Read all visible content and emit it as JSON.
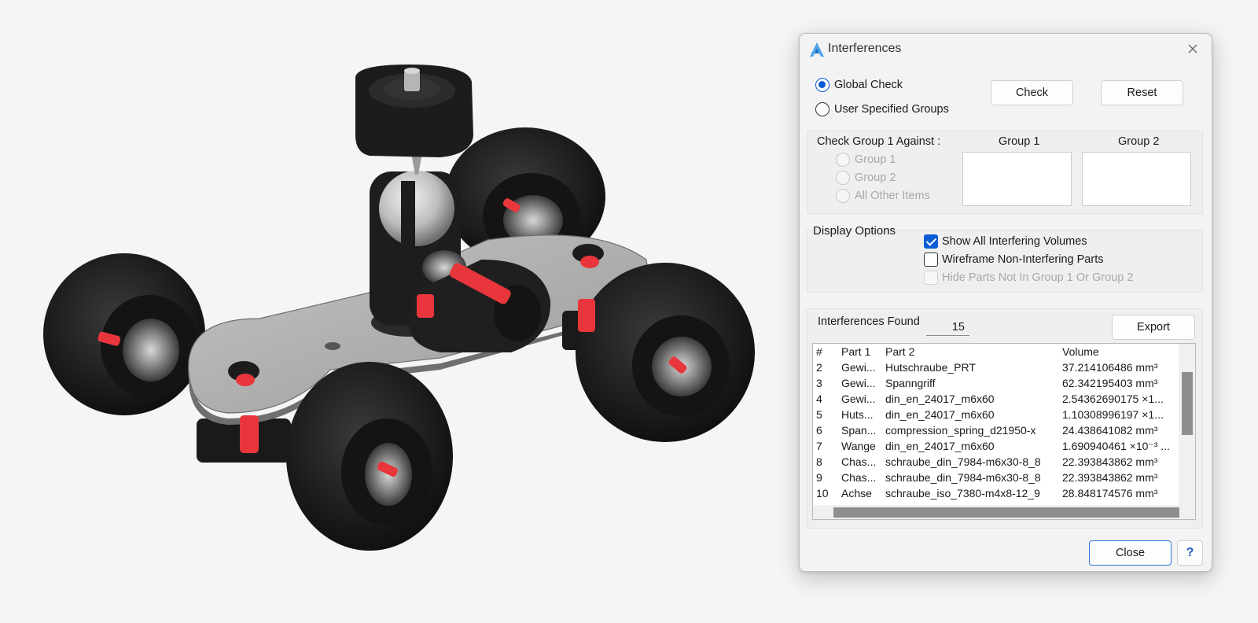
{
  "dialog": {
    "title": "Interferences",
    "mode_global": "Global Check",
    "mode_user": "User Specified Groups",
    "check_label": "Check",
    "reset_label": "Reset",
    "check_group_label": "Check Group 1 Against :",
    "against_group1": "Group 1",
    "against_group2": "Group 2",
    "against_other": "All Other Items",
    "group1_header": "Group 1",
    "group2_header": "Group 2",
    "display_options_label": "Display Options",
    "opt_show_all": "Show All Interfering Volumes",
    "opt_wireframe": "Wireframe Non-Interfering Parts",
    "opt_hide": "Hide Parts Not In Group 1 Or Group 2",
    "interferences_found_label": "Interferences Found",
    "interferences_count": "15",
    "export_label": "Export",
    "close_label": "Close",
    "help_label": "?"
  },
  "table": {
    "headers": [
      "#",
      "Part 1",
      "Part 2",
      "Volume"
    ],
    "rows": [
      [
        "2",
        "Gewi...",
        "Hutschraube_PRT",
        "37.214106486 mm³"
      ],
      [
        "3",
        "Gewi...",
        "Spanngriff",
        "62.342195403 mm³"
      ],
      [
        "4",
        "Gewi...",
        "din_en_24017_m6x60",
        "2.54362690175 ×1..."
      ],
      [
        "5",
        "Huts...",
        "din_en_24017_m6x60",
        "1.10308996197 ×1..."
      ],
      [
        "6",
        "Span...",
        "compression_spring_d21950-x",
        "24.438641082 mm³"
      ],
      [
        "7",
        "Wange",
        "din_en_24017_m6x60",
        "1.690940461 ×10⁻³ ..."
      ],
      [
        "8",
        "Chas...",
        "schraube_din_7984-m6x30-8_8",
        "22.393843862 mm³"
      ],
      [
        "9",
        "Chas...",
        "schraube_din_7984-m6x30-8_8",
        "22.393843862 mm³"
      ],
      [
        "10",
        "Achse",
        "schraube_iso_7380-m4x8-12_9",
        "28.848174576 mm³"
      ]
    ]
  },
  "colors": {
    "accent": "#0a5bd6",
    "interference": "#e8363c",
    "wheel": "#1c1c1c",
    "plate": "#a9a9a9"
  }
}
